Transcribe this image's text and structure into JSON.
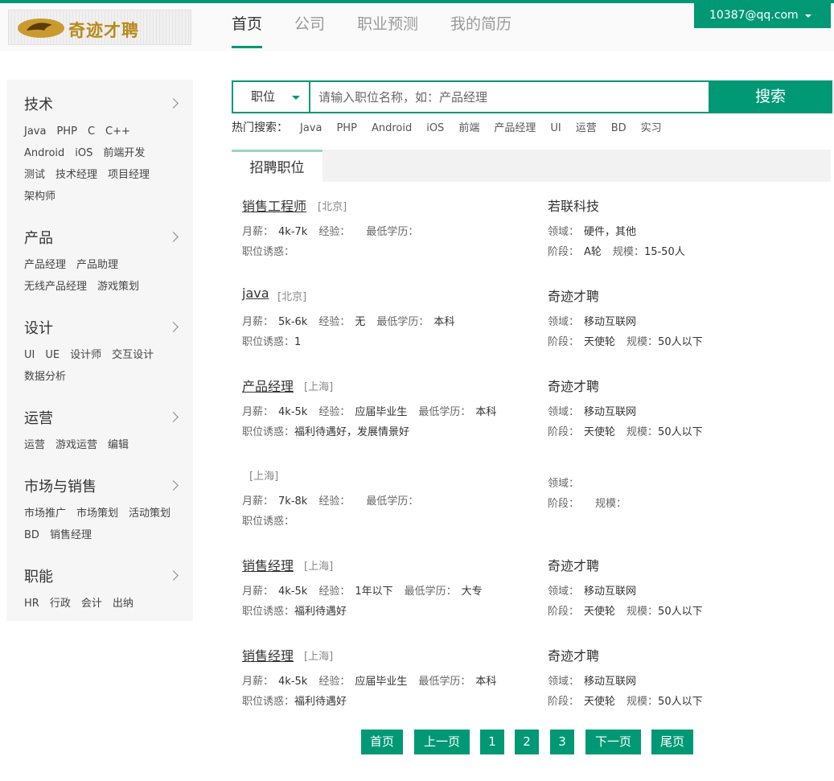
{
  "brand": {
    "logo_text": "奇迹才聘"
  },
  "nav": {
    "items": [
      "首页",
      "公司",
      "职业预测",
      "我的简历"
    ],
    "active_index": 0
  },
  "user": {
    "email": "10387@qq.com"
  },
  "sidebar": {
    "categories": [
      {
        "title": "技术",
        "tags": [
          "Java",
          "PHP",
          "C",
          "C++",
          "Android",
          "iOS",
          "前端开发",
          "测试",
          "技术经理",
          "项目经理",
          "架构师"
        ]
      },
      {
        "title": "产品",
        "tags": [
          "产品经理",
          "产品助理",
          "无线产品经理",
          "游戏策划"
        ]
      },
      {
        "title": "设计",
        "tags": [
          "UI",
          "UE",
          "设计师",
          "交互设计",
          "数据分析"
        ]
      },
      {
        "title": "运营",
        "tags": [
          "运营",
          "游戏运营",
          "编辑"
        ]
      },
      {
        "title": "市场与销售",
        "tags": [
          "市场推广",
          "市场策划",
          "活动策划",
          "BD",
          "销售经理"
        ]
      },
      {
        "title": "职能",
        "tags": [
          "HR",
          "行政",
          "会计",
          "出纳"
        ]
      }
    ]
  },
  "search": {
    "type_label": "职位",
    "placeholder": "请输入职位名称，如：产品经理",
    "button_label": "搜索"
  },
  "hot": {
    "label": "热门搜索：",
    "tags": [
      "Java",
      "PHP",
      "Android",
      "iOS",
      "前端",
      "产品经理",
      "UI",
      "运营",
      "BD",
      "实习"
    ]
  },
  "tabs": {
    "active": "招聘职位"
  },
  "labels": {
    "salary": "月薪：",
    "experience": "经验：",
    "education": "最低学历：",
    "perks": "职位诱惑：",
    "field": "领域：",
    "stage": "阶段：",
    "scale": "规模："
  },
  "jobs": [
    {
      "title": "销售工程师",
      "city": "[北京]",
      "salary": "4k-7k",
      "experience": "",
      "education": "",
      "perks": "",
      "company": "若联科技",
      "field": "硬件，其他",
      "stage": "A轮",
      "scale": "15-50人"
    },
    {
      "title": "java",
      "city": "[北京]",
      "salary": "5k-6k",
      "experience": "无",
      "education": "本科",
      "perks": "1",
      "company": "奇迹才聘",
      "field": "移动互联网",
      "stage": "天使轮",
      "scale": "50人以下"
    },
    {
      "title": "产品经理",
      "city": "[上海]",
      "salary": "4k-5k",
      "experience": "应届毕业生",
      "education": "本科",
      "perks": "福利待遇好，发展情景好",
      "company": "奇迹才聘",
      "field": "移动互联网",
      "stage": "天使轮",
      "scale": "50人以下"
    },
    {
      "title": "",
      "city": "[上海]",
      "salary": "7k-8k",
      "experience": "",
      "education": "",
      "perks": "",
      "company": "",
      "field": "",
      "stage": "",
      "scale": ""
    },
    {
      "title": "销售经理",
      "city": "[上海]",
      "salary": "4k-5k",
      "experience": "1年以下",
      "education": "大专",
      "perks": "福利待遇好",
      "company": "奇迹才聘",
      "field": "移动互联网",
      "stage": "天使轮",
      "scale": "50人以下"
    },
    {
      "title": "销售经理",
      "city": "[上海]",
      "salary": "4k-5k",
      "experience": "应届毕业生",
      "education": "本科",
      "perks": "福利待遇好",
      "company": "奇迹才聘",
      "field": "移动互联网",
      "stage": "天使轮",
      "scale": "50人以下"
    }
  ],
  "pagination": {
    "first": "首页",
    "prev": "上一页",
    "pages": [
      "1",
      "2",
      "3"
    ],
    "next": "下一页",
    "last": "尾页"
  }
}
